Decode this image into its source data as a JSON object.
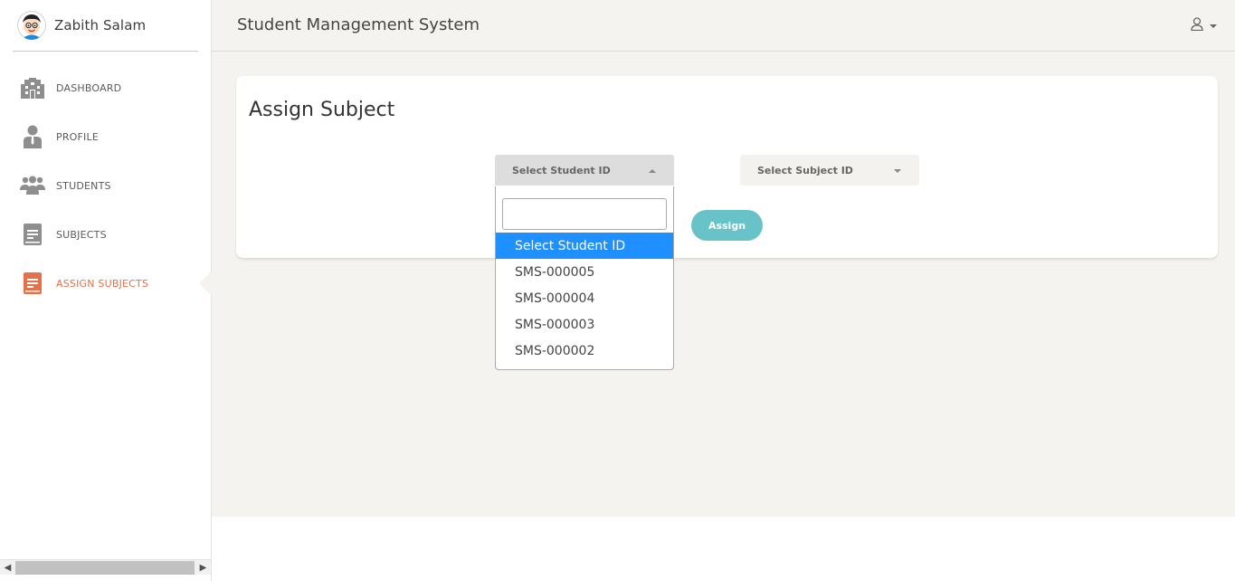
{
  "sidebar": {
    "user_name": "Zabith Salam",
    "items": [
      {
        "label": "DASHBOARD",
        "icon": "building-icon"
      },
      {
        "label": "PROFILE",
        "icon": "person-icon"
      },
      {
        "label": "STUDENTS",
        "icon": "group-icon"
      },
      {
        "label": "SUBJECTS",
        "icon": "book-icon"
      },
      {
        "label": "ASSIGN SUBJECTS",
        "icon": "book-icon",
        "active": true
      }
    ]
  },
  "header": {
    "title": "Student Management System"
  },
  "card": {
    "title": "Assign Subject",
    "student_select": {
      "selected": "Select Student ID"
    },
    "subject_select": {
      "selected": "Select Subject ID"
    },
    "assign_label": "Assign"
  },
  "dropdown": {
    "search_value": "",
    "options": [
      "Select Student ID",
      "SMS-000005",
      "SMS-000004",
      "SMS-000003",
      "SMS-000002"
    ],
    "highlighted": "Select Student ID"
  },
  "colors": {
    "accent": "#e3714a",
    "button": "#68c3c8",
    "highlight": "#1e90ff",
    "background": "#f4f3ef"
  }
}
